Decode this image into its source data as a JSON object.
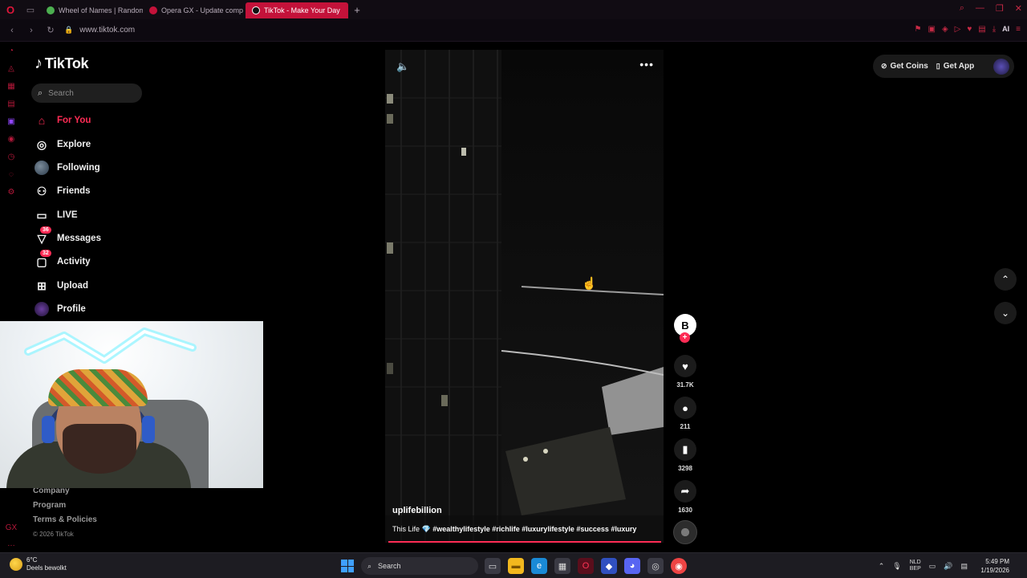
{
  "browser": {
    "tabs": [
      {
        "title": "Wheel of Names | Random",
        "favicon_color": "#4caf50",
        "active": false
      },
      {
        "title": "Opera GX - Update comp",
        "favicon_color": "#c4123a",
        "active": false
      },
      {
        "title": "TikTok - Make Your Day",
        "favicon_color": "#111111",
        "active": true
      }
    ],
    "url": "www.tiktok.com",
    "tools_ai_label": "AI"
  },
  "tiktok": {
    "logo_text": "TikTok",
    "search_placeholder": "Search",
    "nav": [
      {
        "label": "For You",
        "icon": "home-icon",
        "badge": ""
      },
      {
        "label": "Explore",
        "icon": "compass-icon",
        "badge": ""
      },
      {
        "label": "Following",
        "icon": "following-avatar",
        "badge": ""
      },
      {
        "label": "Friends",
        "icon": "friends-icon",
        "badge": ""
      },
      {
        "label": "LIVE",
        "icon": "live-icon",
        "badge": ""
      },
      {
        "label": "Messages",
        "icon": "messages-icon",
        "badge": "36"
      },
      {
        "label": "Activity",
        "icon": "activity-icon",
        "badge": "32"
      },
      {
        "label": "Upload",
        "icon": "upload-icon",
        "badge": ""
      },
      {
        "label": "Profile",
        "icon": "profile-avatar",
        "badge": ""
      }
    ],
    "footer": {
      "company": "Company",
      "program": "Program",
      "terms": "Terms & Policies",
      "copyright": "© 2026 TikTok"
    },
    "top_right": {
      "get_coins": "Get Coins",
      "get_app": "Get App"
    },
    "video": {
      "username": "uplifebillion",
      "caption_text": "This Life 💎",
      "caption_tags": "#wealthylifestyle #richlife #luxurylifestyle #success #luxury",
      "likes": "31.7K",
      "comments": "211",
      "saves": "3298",
      "shares": "1630"
    }
  },
  "taskbar": {
    "weather_temp": "6°C",
    "weather_desc": "Deels bewolkt",
    "search_placeholder": "Search",
    "lang_line1": "NLD",
    "lang_line2": "BEP",
    "time": "5:49 PM",
    "date": "1/19/2026"
  }
}
